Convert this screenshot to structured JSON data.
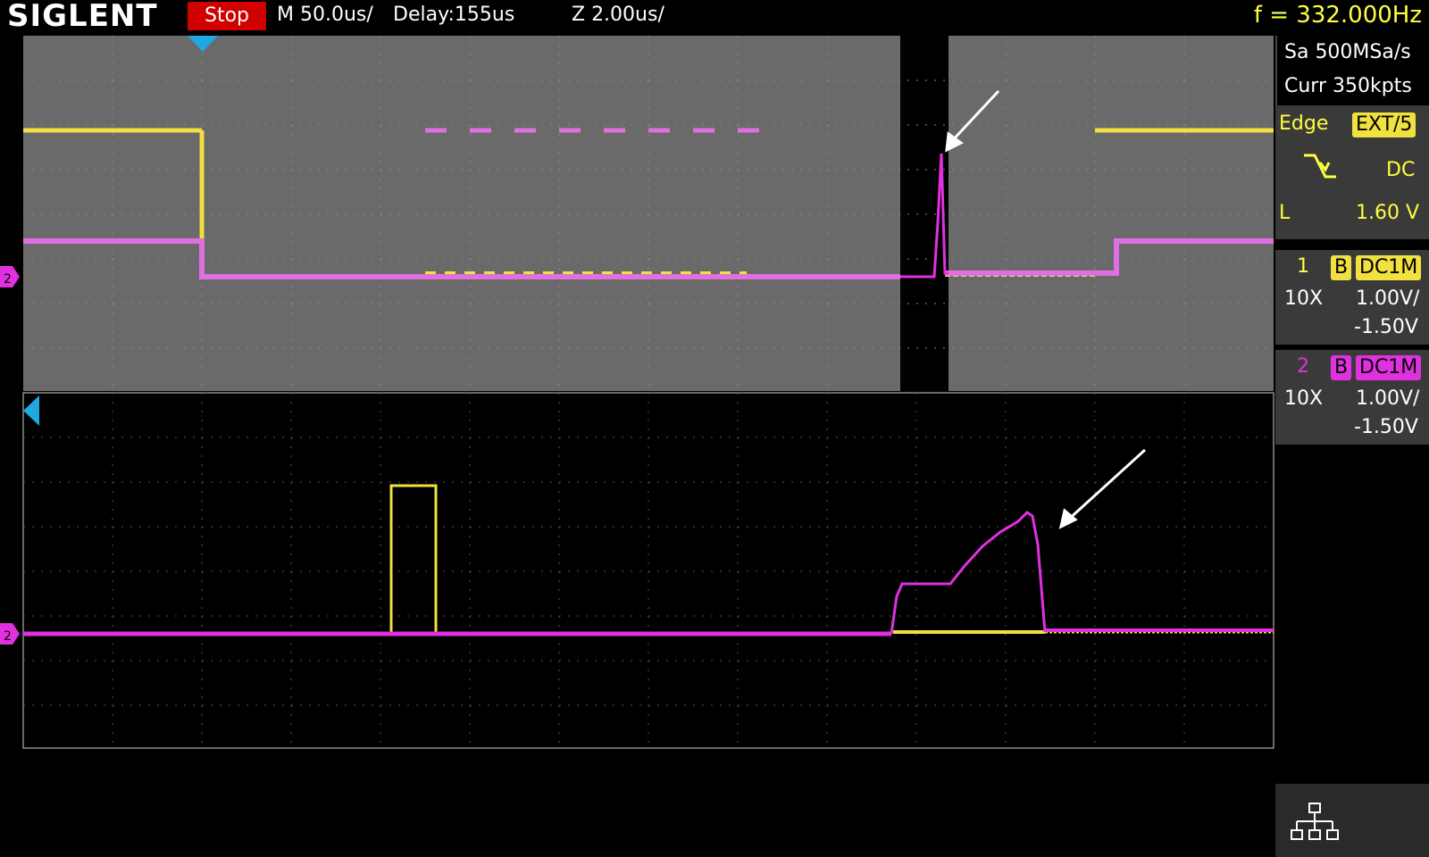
{
  "header": {
    "brand": "SIGLENT",
    "run_state": "Stop",
    "timebase": "M 50.0us/",
    "delay": "Delay:155us",
    "zoom": "Z 2.00us/",
    "frequency": "f = 332.000Hz"
  },
  "acquisition": {
    "sample_rate": "Sa 500MSa/s",
    "memory": "Curr 350kpts"
  },
  "trigger": {
    "type": "Edge",
    "source": "EXT/5",
    "slope_icon": "falling-edge-icon",
    "coupling": "DC",
    "level_label": "L",
    "level_value": "1.60 V"
  },
  "channels": [
    {
      "number": "1",
      "bandwidth": "B",
      "coupling": "DC1M",
      "probe": "10X",
      "scale": "1.00V/",
      "offset": "-1.50V",
      "color": "#f0e040"
    },
    {
      "number": "2",
      "bandwidth": "B",
      "coupling": "DC1M",
      "probe": "10X",
      "scale": "1.00V/",
      "offset": "-1.50V",
      "color": "#e030e0"
    }
  ],
  "markers": {
    "ch2_marker_top": "2",
    "ch2_marker_bottom": "2"
  },
  "network_icon": "network-icon",
  "colors": {
    "ch1": "#f0e040",
    "ch2": "#e030e0",
    "trigger_marker": "#20a8e0",
    "stop_bg": "#d00000"
  }
}
